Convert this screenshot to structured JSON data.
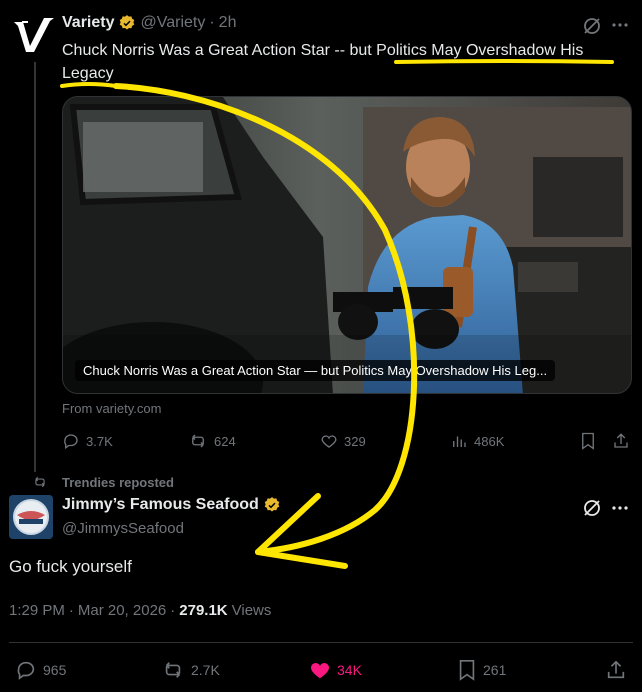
{
  "top_tweet": {
    "display_name": "Variety",
    "handle": "@Variety",
    "separator": "·",
    "time": "2h",
    "text": "Chuck Norris Was a Great Action Star -- but Politics May Overshadow His Legacy",
    "card_caption": "Chuck Norris Was a Great Action Star — but Politics May Overshadow His Leg...",
    "from_label": "From variety.com",
    "replies": "3.7K",
    "reposts": "624",
    "likes": "329",
    "views": "486K"
  },
  "repost_note": "Trendies reposted",
  "main_tweet": {
    "display_name": "Jimmy’s Famous Seafood",
    "handle": "@JimmysSeafood",
    "text": "Go fuck yourself",
    "time": "1:29 PM",
    "dot": "·",
    "date": "Mar 20, 2026",
    "dot2": "·",
    "views_count": "279.1K",
    "views_label": "Views",
    "replies": "965",
    "reposts": "2.7K",
    "likes": "34K",
    "bookmarks": "261"
  },
  "colors": {
    "background": "#000000",
    "muted": "#71767b",
    "liked": "#f91880",
    "annotation": "#ffe600",
    "verified": "#e8b82f"
  }
}
